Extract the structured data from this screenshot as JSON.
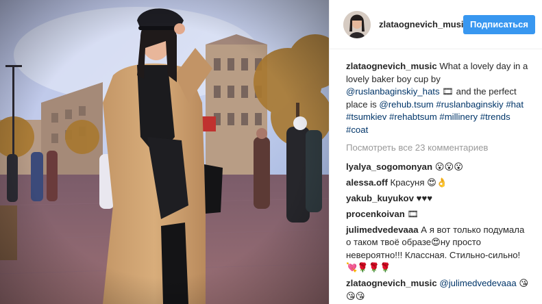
{
  "header": {
    "username": "zlataognevich_music",
    "follow_label": "Подписаться"
  },
  "caption": {
    "username": "zlataognevich_music",
    "text_1": "What a lovely day in a lovely baker boy cup by",
    "mention_1": "@ruslanbaginskiy_hats",
    "text_2": "🎞 and the perfect place is",
    "mention_2": "@rehub.tsum",
    "tags": [
      "#ruslanbaginskiy",
      "#hat",
      "#tsumkiev",
      "#rehabtsum",
      "#millinery",
      "#trends",
      "#coat"
    ]
  },
  "view_all_label": "Посмотреть все 23 комментариев",
  "comments": [
    {
      "user": "lyalya_sogomonyan",
      "text": "😮😮😮"
    },
    {
      "user": "alessa.off",
      "text": "Красуня 😍👌"
    },
    {
      "user": "yakub_kuyukov",
      "text": "♥♥♥"
    },
    {
      "user": "procenkoivan",
      "text": "🎞"
    },
    {
      "user": "julimedvedevaaa",
      "text": "А я вот только подумала о таком твоё образе😍ну просто невероятно!!! Классная. Стильно-сильно! 💘🌹🌹🌹"
    },
    {
      "user": "zlataognevich_music",
      "mention": "@julimedvedevaaa",
      "text": "😘😘😘"
    }
  ],
  "colors": {
    "follow_button": "#3897f0",
    "link": "#003569",
    "muted": "#999999"
  }
}
